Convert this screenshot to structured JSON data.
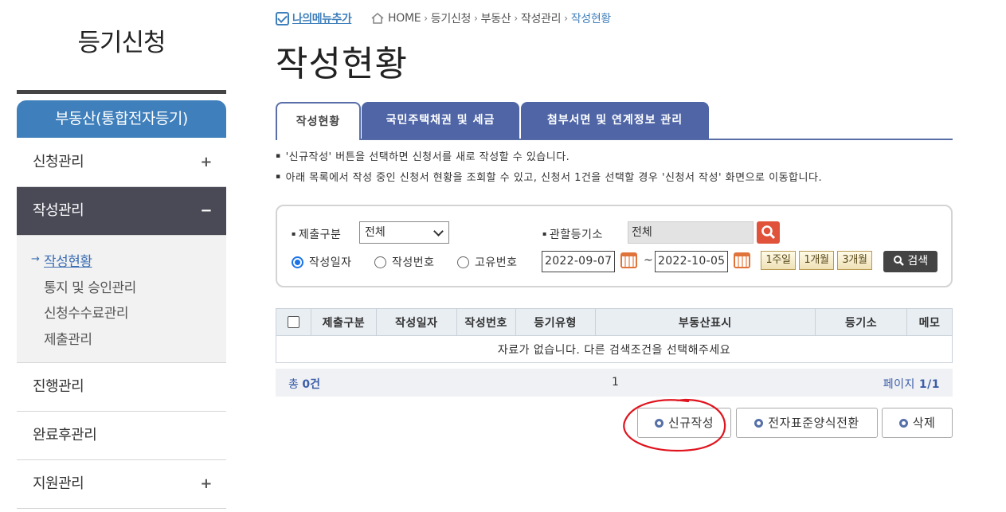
{
  "sidebar": {
    "title": "등기신청",
    "category": "부동산(통합전자등기)",
    "items": [
      {
        "label": "신청관리",
        "toggle": "+"
      },
      {
        "label": "작성관리",
        "toggle": "−"
      },
      {
        "label": "진행관리",
        "toggle": ""
      },
      {
        "label": "완료후관리",
        "toggle": ""
      },
      {
        "label": "지원관리",
        "toggle": "+"
      }
    ],
    "subitems": [
      "작성현황",
      "통지 및 승인관리",
      "신청수수료관리",
      "제출관리"
    ],
    "sub_arrow": "→"
  },
  "breadcrumb": {
    "mymenu": "나의메뉴추가",
    "items": [
      "HOME",
      "등기신청",
      "부동산",
      "작성관리",
      "작성현황"
    ],
    "sep": "›"
  },
  "page_title": "작성현황",
  "tabs": [
    "작성현황",
    "국민주택채권 및 세금",
    "첨부서면 및 연계정보 관리"
  ],
  "notes": [
    "'신규작성' 버튼을 선택하면 신청서를 새로 작성할 수 있습니다.",
    "아래 목록에서 작성 중인 신청서 현황을 조회할 수 있고, 신청서 1건을 선택할 경우 '신청서 작성' 화면으로 이동합니다."
  ],
  "bullet": "▪",
  "search": {
    "submit_label": "제출구분",
    "submit_value": "전체",
    "office_label": "관할등기소",
    "office_value": "전체",
    "radios": [
      "작성일자",
      "작성번호",
      "고유번호"
    ],
    "radio_selected": "작성일자",
    "date_from": "2022-09-07",
    "date_to": "2022-10-05",
    "tilde": "~",
    "periods": [
      "1주일",
      "1개월",
      "3개월"
    ],
    "search_button": "검색"
  },
  "table": {
    "headers": [
      "제출구분",
      "작성일자",
      "작성번호",
      "등기유형",
      "부동산표시",
      "등기소",
      "메모"
    ],
    "empty_message": "자료가 없습니다. 다른 검색조건을 선택해주세요"
  },
  "pagination": {
    "total_prefix": "총",
    "total_count": "0건",
    "current_page": "1",
    "page_label": "페이지",
    "page_info": "1/1"
  },
  "actions": [
    "신규작성",
    "전자표준양식전환",
    "삭제"
  ],
  "colors": {
    "accent_blue": "#3f7fbb",
    "tab_blue": "#4f65a6",
    "active_menu": "#4a4a57",
    "annotation_red": "#e0141e"
  }
}
